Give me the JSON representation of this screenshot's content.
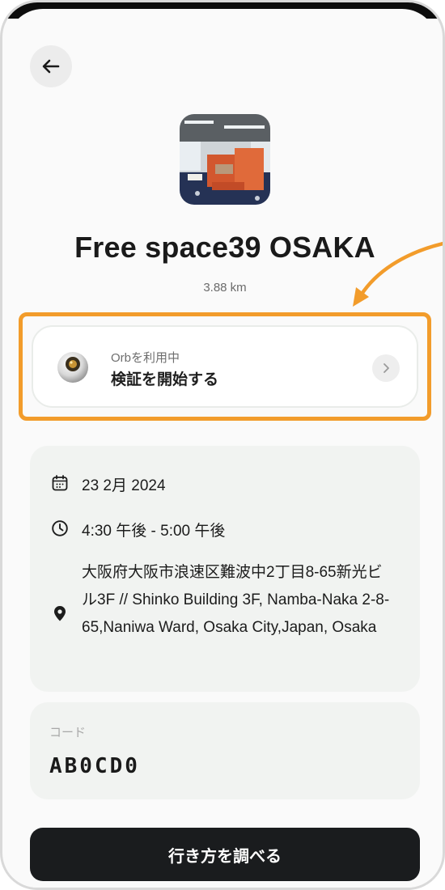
{
  "header": {
    "back_icon": "arrow-left-icon"
  },
  "venue": {
    "name": "Free space39 OSAKA",
    "distance": "3.88 km",
    "thumbnail": "office-lounge-photo"
  },
  "orb": {
    "caption": "Orbを利用中",
    "action": "検証を開始する",
    "icon": "orb-device-icon",
    "chevron_icon": "chevron-right-icon"
  },
  "details": {
    "date": "23 2月 2024",
    "time": "4:30 午後 - 5:00 午後",
    "address": "大阪府大阪市浪速区難波中2丁目8-65新光ビル3F // Shinko Building 3F, Namba-Naka 2-8-65,Naniwa Ward, Osaka City,Japan, Osaka",
    "date_icon": "calendar-icon",
    "time_icon": "clock-icon",
    "address_icon": "location-pin-icon"
  },
  "code": {
    "label": "コード",
    "value": "AB0CD0"
  },
  "footer": {
    "directions_label": "行き方を調べる"
  },
  "colors": {
    "highlight": "#f29c2b",
    "button_bg": "#1a1c1e",
    "card_bg": "#f1f3f1"
  }
}
